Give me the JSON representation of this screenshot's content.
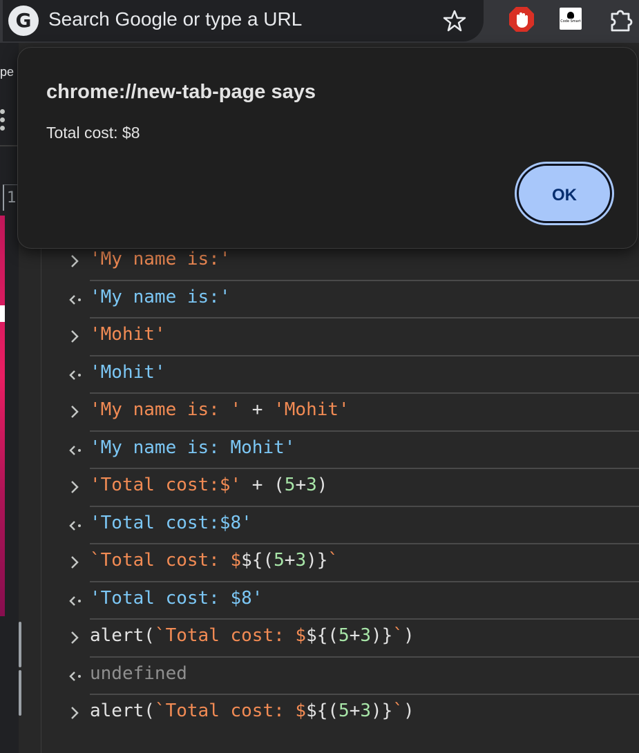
{
  "omnibox": {
    "placeholder": "Search Google or type a URL",
    "logo_letter": "G"
  },
  "extensions": {
    "codesmart_label": "Code Smart"
  },
  "left_page": {
    "partial_text": "pe",
    "ruler_digit": "1"
  },
  "dialog": {
    "title": "chrome://new-tab-page says",
    "message": "Total cost: $8",
    "ok_label": "OK",
    "accent_color": "#a8c7fa"
  },
  "console": {
    "entries": [
      {
        "kind": "input",
        "parts": [
          {
            "t": "'My name is:'",
            "c": "s"
          }
        ]
      },
      {
        "kind": "output",
        "parts": [
          {
            "t": "'My name is:'",
            "c": "r"
          }
        ]
      },
      {
        "kind": "input",
        "parts": [
          {
            "t": "'Mohit'",
            "c": "s"
          }
        ]
      },
      {
        "kind": "output",
        "parts": [
          {
            "t": "'Mohit'",
            "c": "r"
          }
        ]
      },
      {
        "kind": "input",
        "parts": [
          {
            "t": "'My name is: '",
            "c": "s"
          },
          {
            "t": " + ",
            "c": "p"
          },
          {
            "t": "'Mohit'",
            "c": "s"
          }
        ]
      },
      {
        "kind": "output",
        "parts": [
          {
            "t": "'My name is: Mohit'",
            "c": "r"
          }
        ]
      },
      {
        "kind": "input",
        "parts": [
          {
            "t": "'Total cost:$'",
            "c": "s"
          },
          {
            "t": " + (",
            "c": "p"
          },
          {
            "t": "5",
            "c": "n"
          },
          {
            "t": "+",
            "c": "p"
          },
          {
            "t": "3",
            "c": "n"
          },
          {
            "t": ")",
            "c": "p"
          }
        ]
      },
      {
        "kind": "output",
        "parts": [
          {
            "t": "'Total cost:$8'",
            "c": "r"
          }
        ]
      },
      {
        "kind": "input",
        "parts": [
          {
            "t": "`Total cost: $",
            "c": "s"
          },
          {
            "t": "${(",
            "c": "p"
          },
          {
            "t": "5",
            "c": "n"
          },
          {
            "t": "+",
            "c": "p"
          },
          {
            "t": "3",
            "c": "n"
          },
          {
            "t": ")}",
            "c": "p"
          },
          {
            "t": "`",
            "c": "s"
          }
        ]
      },
      {
        "kind": "output",
        "parts": [
          {
            "t": "'Total cost: $8'",
            "c": "r"
          }
        ]
      },
      {
        "kind": "input",
        "parts": [
          {
            "t": "alert(",
            "c": "p"
          },
          {
            "t": "`Total cost: $",
            "c": "s"
          },
          {
            "t": "${(",
            "c": "p"
          },
          {
            "t": "5",
            "c": "n"
          },
          {
            "t": "+",
            "c": "p"
          },
          {
            "t": "3",
            "c": "n"
          },
          {
            "t": ")}",
            "c": "p"
          },
          {
            "t": "`",
            "c": "s"
          },
          {
            "t": ")",
            "c": "p"
          }
        ]
      },
      {
        "kind": "output",
        "parts": [
          {
            "t": "undefined",
            "c": "u"
          }
        ]
      },
      {
        "kind": "input",
        "parts": [
          {
            "t": "alert(",
            "c": "p"
          },
          {
            "t": "`Total cost: $",
            "c": "s"
          },
          {
            "t": "${(",
            "c": "p"
          },
          {
            "t": "5",
            "c": "n"
          },
          {
            "t": "+",
            "c": "p"
          },
          {
            "t": "3",
            "c": "n"
          },
          {
            "t": ")}",
            "c": "p"
          },
          {
            "t": "`",
            "c": "s"
          },
          {
            "t": ")",
            "c": "p"
          }
        ]
      }
    ]
  },
  "icons": [
    "google-logo-icon",
    "bookmark-star-icon",
    "ublock-icon",
    "code-smart-icon",
    "extensions-puzzle-icon",
    "input-chevron-icon",
    "output-arrow-icon"
  ]
}
